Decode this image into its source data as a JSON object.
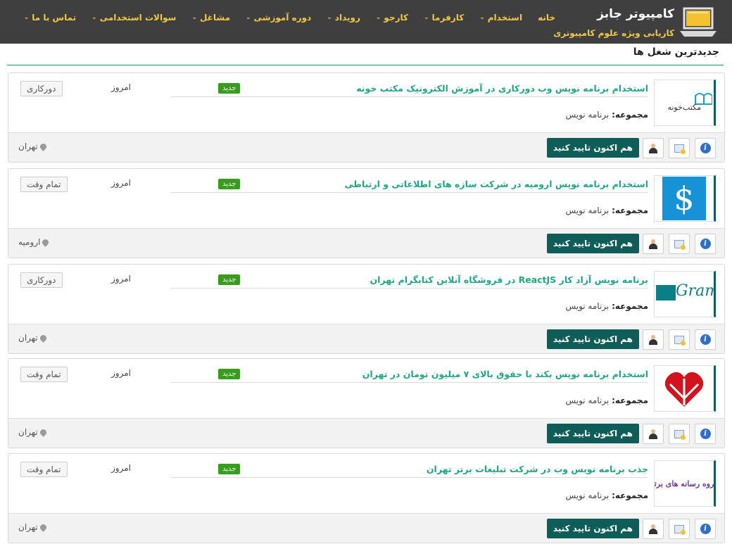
{
  "site": {
    "title": "کامپیوتر جابز",
    "subtitle": "کاریابی ویژه علوم کامپیوتری"
  },
  "nav": [
    {
      "label": "خانه",
      "has_dropdown": false
    },
    {
      "label": "استخدام",
      "has_dropdown": true
    },
    {
      "label": "کارفرما",
      "has_dropdown": true
    },
    {
      "label": "کارجو",
      "has_dropdown": true
    },
    {
      "label": "رویداد",
      "has_dropdown": true
    },
    {
      "label": "دوره آموزشی",
      "has_dropdown": true
    },
    {
      "label": "مشاغل",
      "has_dropdown": true
    },
    {
      "label": "سوالات استخدامی",
      "has_dropdown": true
    },
    {
      "label": "تماس با ما",
      "has_dropdown": true
    }
  ],
  "section_title": "جدیدترین شغل ها",
  "common": {
    "category_label": "مجموعه:",
    "new_badge": "جدید",
    "confirm_button": "هم اکنون تایید کنید"
  },
  "jobs": [
    {
      "title": "استخدام برنامه نویس وب دورکاری در آموزش الکترونیک مکتب خونه",
      "category": "برنامه نویس",
      "date": "امروز",
      "type": "دورکاری",
      "location": "تهران",
      "logo_text": "مکتب‌خونه"
    },
    {
      "title": "استخدام برنامه نویس ارومیه در شرکت سازه های اطلاعاتی و ارتباطی",
      "category": "برنامه نویس",
      "date": "امروز",
      "type": "تمام وقت",
      "location": "ارومیه",
      "logo_text": ""
    },
    {
      "title": "برنامه نویس آزاد کار ReactJS در فروشگاه آنلاین کتابگرام تهران",
      "category": "برنامه نویس",
      "date": "امروز",
      "type": "دورکاری",
      "location": "تهران",
      "logo_text": "Gram"
    },
    {
      "title": "استخدام برنامه نویس بکند با حقوق بالای ۷ میلیون تومان در تهران",
      "category": "برنامه نویس",
      "date": "امروز",
      "type": "تمام وقت",
      "location": "تهران",
      "logo_text": ""
    },
    {
      "title": "جذب برنامه نویس وب در شرکت تبلیغات برتر تهران",
      "category": "برنامه نویس",
      "date": "امروز",
      "type": "تمام وقت",
      "location": "تهران",
      "logo_text": "گروه رسانه های برتر"
    }
  ],
  "colors": {
    "header_bg": "#3f3f3f",
    "nav_text": "#f5c842",
    "title_green": "#1ea882",
    "button_teal": "#0f5d58",
    "badge_green": "#3a9c1f"
  }
}
